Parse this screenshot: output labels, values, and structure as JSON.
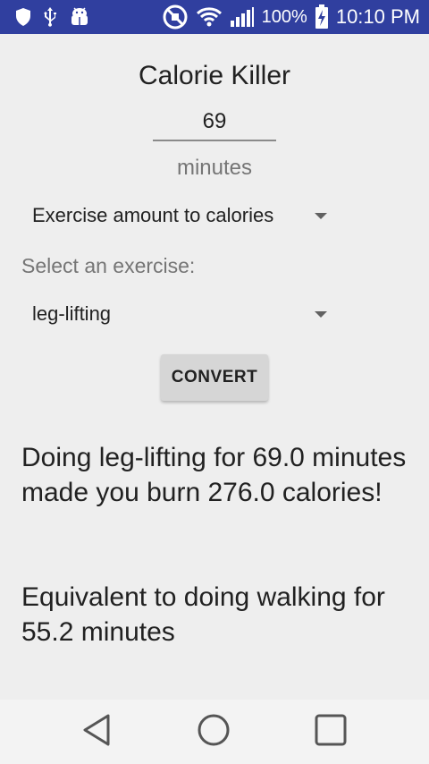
{
  "status_bar": {
    "icons_left": [
      "shield-icon",
      "usb-icon",
      "android-debug-icon"
    ],
    "icons_right": [
      "no-sound-icon",
      "wifi-icon",
      "signal-icon",
      "battery-charging-icon"
    ],
    "battery": "100%",
    "time": "10:10 PM",
    "bar_color": "#303f9f"
  },
  "app": {
    "title": "Calorie Killer",
    "amount_value": "69",
    "units": "minutes",
    "mode_selected": "Exercise amount to calories",
    "select_prompt": "Select an exercise:",
    "exercise_selected": "leg-lifting",
    "convert_label": "CONVERT",
    "result_text": "Doing leg-lifting for 69.0 minutes made you burn 276.0 calories!",
    "equivalent_text": "Equivalent to doing walking for 55.2 minutes"
  },
  "nav_bar": {
    "buttons": [
      "back-icon",
      "home-icon",
      "recents-icon"
    ]
  }
}
